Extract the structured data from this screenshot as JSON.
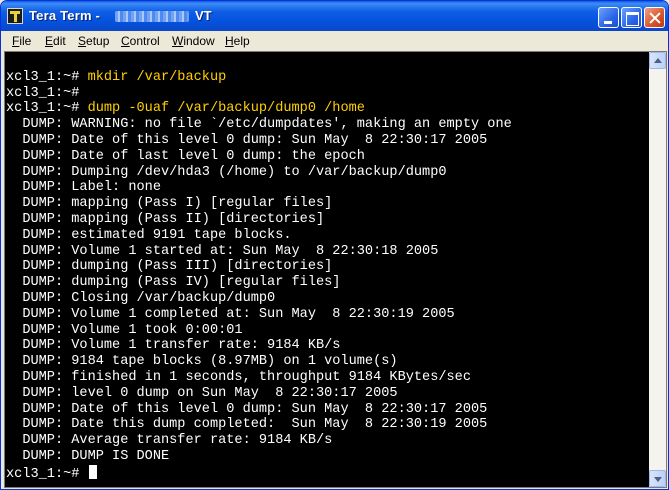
{
  "window": {
    "title": "Tera Term -",
    "title_suffix": "VT"
  },
  "menu": [
    {
      "label": "File",
      "mnemonic": "F"
    },
    {
      "label": "Edit",
      "mnemonic": "E"
    },
    {
      "label": "Setup",
      "mnemonic": "S"
    },
    {
      "label": "Control",
      "mnemonic": "C"
    },
    {
      "label": "Window",
      "mnemonic": "W"
    },
    {
      "label": "Help",
      "mnemonic": "H"
    }
  ],
  "terminal": {
    "lines": [
      {
        "prompt": "",
        "text": ""
      },
      {
        "prompt": "xcl3_1:~# ",
        "text": "mkdir /var/backup"
      },
      {
        "prompt": "xcl3_1:~# ",
        "text": ""
      },
      {
        "prompt": "xcl3_1:~# ",
        "text": "dump -0uaf /var/backup/dump0 /home"
      },
      {
        "prompt": "",
        "text": "  DUMP: WARNING: no file `/etc/dumpdates', making an empty one"
      },
      {
        "prompt": "",
        "text": "  DUMP: Date of this level 0 dump: Sun May  8 22:30:17 2005"
      },
      {
        "prompt": "",
        "text": "  DUMP: Date of last level 0 dump: the epoch"
      },
      {
        "prompt": "",
        "text": "  DUMP: Dumping /dev/hda3 (/home) to /var/backup/dump0"
      },
      {
        "prompt": "",
        "text": "  DUMP: Label: none"
      },
      {
        "prompt": "",
        "text": "  DUMP: mapping (Pass I) [regular files]"
      },
      {
        "prompt": "",
        "text": "  DUMP: mapping (Pass II) [directories]"
      },
      {
        "prompt": "",
        "text": "  DUMP: estimated 9191 tape blocks."
      },
      {
        "prompt": "",
        "text": "  DUMP: Volume 1 started at: Sun May  8 22:30:18 2005"
      },
      {
        "prompt": "",
        "text": "  DUMP: dumping (Pass III) [directories]"
      },
      {
        "prompt": "",
        "text": "  DUMP: dumping (Pass IV) [regular files]"
      },
      {
        "prompt": "",
        "text": "  DUMP: Closing /var/backup/dump0"
      },
      {
        "prompt": "",
        "text": "  DUMP: Volume 1 completed at: Sun May  8 22:30:19 2005"
      },
      {
        "prompt": "",
        "text": "  DUMP: Volume 1 took 0:00:01"
      },
      {
        "prompt": "",
        "text": "  DUMP: Volume 1 transfer rate: 9184 KB/s"
      },
      {
        "prompt": "",
        "text": "  DUMP: 9184 tape blocks (8.97MB) on 1 volume(s)"
      },
      {
        "prompt": "",
        "text": "  DUMP: finished in 1 seconds, throughput 9184 KBytes/sec"
      },
      {
        "prompt": "",
        "text": "  DUMP: level 0 dump on Sun May  8 22:30:17 2005"
      },
      {
        "prompt": "",
        "text": "  DUMP: Date of this level 0 dump: Sun May  8 22:30:17 2005"
      },
      {
        "prompt": "",
        "text": "  DUMP: Date this dump completed:  Sun May  8 22:30:19 2005"
      },
      {
        "prompt": "",
        "text": "  DUMP: Average transfer rate: 9184 KB/s"
      },
      {
        "prompt": "",
        "text": "  DUMP: DUMP IS DONE"
      },
      {
        "prompt": "xcl3_1:~# ",
        "text": ""
      }
    ]
  },
  "colors": {
    "terminal_bg": "#000000",
    "terminal_fg": "#ffffff",
    "command_fg": "#ffd000",
    "titlebar": "#0551dd"
  },
  "icons": [
    "tera-term-app-icon",
    "minimize-icon",
    "maximize-icon",
    "close-icon",
    "scroll-up-arrow-icon",
    "scroll-down-arrow-icon"
  ]
}
